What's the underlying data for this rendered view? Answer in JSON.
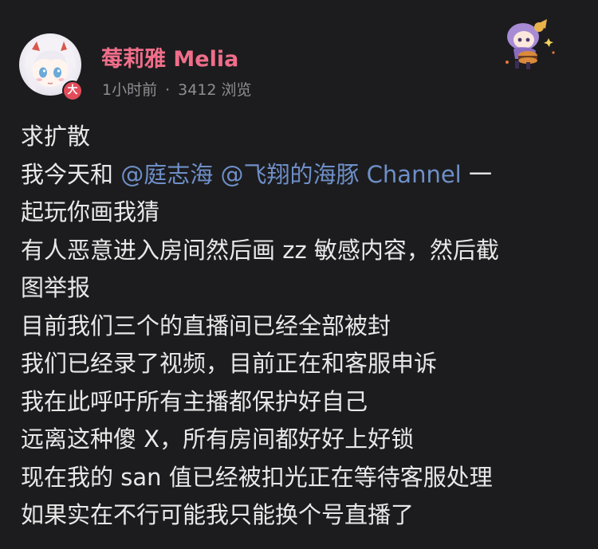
{
  "post": {
    "author": {
      "name": "莓莉雅 Melia",
      "badge": "大"
    },
    "meta": {
      "time": "1小时前",
      "separator": "·",
      "views": "3412 浏览"
    },
    "content": {
      "line1": "求扩散",
      "line2_prefix": "我今天和 ",
      "mention1": "@庭志海",
      "line2_space": " ",
      "mention2": "@飞翔的海豚 Channel",
      "line2_suffix": " 一",
      "line3": "起玩你画我猜",
      "line4": "有人恶意进入房间然后画 zz 敏感内容，然后截",
      "line5": "图举报",
      "line6": "目前我们三个的直播间已经全部被封",
      "line7": "我们已经录了视频，目前正在和客服申诉",
      "line8": "我在此呼吁所有主播都保护好自己",
      "line9": "远离这种傻 X，所有房间都好好上好锁",
      "line10": "现在我的 san 值已经被扣光正在等待客服处理",
      "line11": "如果实在不行可能我只能换个号直播了"
    },
    "colors": {
      "background": "#1c1c1e",
      "username": "#f06e8a",
      "mention": "#6e8fc8",
      "meta": "#8e8e93",
      "badge": "#e24c5a"
    },
    "icons": {
      "avatar": "anime-girl-avatar",
      "sticker": "anime-character-sticker"
    }
  }
}
